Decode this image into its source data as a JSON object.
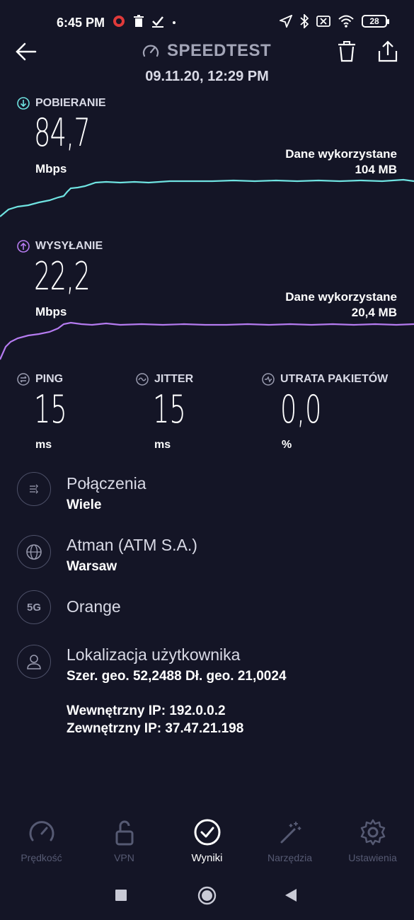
{
  "status_bar": {
    "time": "6:45 PM",
    "battery": "28"
  },
  "header": {
    "title": "SPEEDTEST",
    "date": "09.11.20, 12:29 PM"
  },
  "download": {
    "label": "POBIERANIE",
    "value": "84,7",
    "unit": "Mbps",
    "data_used_label": "Dane wykorzystane",
    "data_used_value": "104 MB",
    "color": "#6fe3e1"
  },
  "upload": {
    "label": "WYSYŁANIE",
    "value": "22,2",
    "unit": "Mbps",
    "data_used_label": "Dane wykorzystane",
    "data_used_value": "20,4 MB",
    "color": "#b57bf0"
  },
  "stats": {
    "ping": {
      "label": "PING",
      "value": "15",
      "unit": "ms"
    },
    "jitter": {
      "label": "JITTER",
      "value": "15",
      "unit": "ms"
    },
    "packet_loss": {
      "label": "UTRATA PAKIETÓW",
      "value": "0,0",
      "unit": "%"
    }
  },
  "info": {
    "connections": {
      "title": "Połączenia",
      "value": "Wiele"
    },
    "server": {
      "title": "Atman (ATM S.A.)",
      "value": "Warsaw"
    },
    "carrier": {
      "badge": "5G",
      "title": "Orange"
    },
    "location": {
      "title": "Lokalizacja użytkownika",
      "coords": "Szer. geo. 52,2488 Dł. geo. 21,0024",
      "internal_ip": "Wewnętrzny IP: 192.0.0.2",
      "external_ip": "Zewnętrzny IP: 37.47.21.198"
    }
  },
  "nav": {
    "items": [
      {
        "label": "Prędkość",
        "icon": "speedometer-icon"
      },
      {
        "label": "VPN",
        "icon": "lock-icon"
      },
      {
        "label": "Wyniki",
        "icon": "check-circle-icon",
        "active": true
      },
      {
        "label": "Narzędzia",
        "icon": "magic-wand-icon"
      },
      {
        "label": "Ustawienia",
        "icon": "gear-icon"
      }
    ]
  },
  "colors": {
    "background": "#141526",
    "download": "#6fe3e1",
    "upload": "#b57bf0",
    "inactive_nav": "#565a73"
  }
}
